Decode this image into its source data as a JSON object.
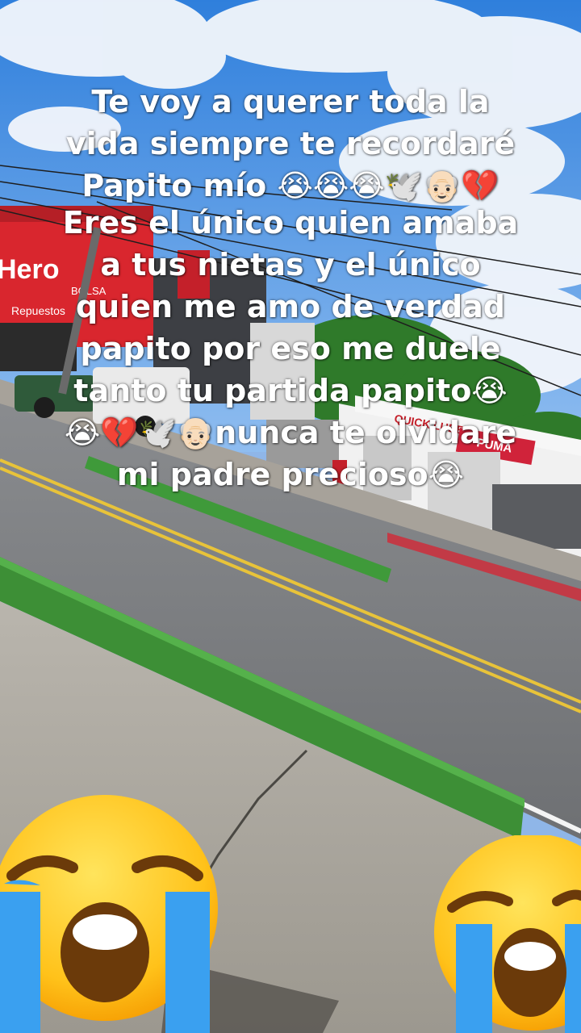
{
  "caption": {
    "line1": "Te voy a querer toda la",
    "line2": "vida siempre te recordaré",
    "line3": "Papito mío 😭😭😭🕊️👴🏻💔",
    "line4": "Eres el único quien amaba",
    "line5": "a tus nietas y el único",
    "line6": "quien me amo de verdad",
    "line7": "papito por eso me duele",
    "line8": "tanto tu partida papito😭",
    "line9": "😭💔🕊️👴🏻nunca te olvidare",
    "line10": "mi padre precioso😭"
  },
  "signs": {
    "hero": "Hero",
    "bolsa": "BOLSA",
    "repuestos": "Repuestos",
    "quick_lube": "QUICK LUBE",
    "puma": "PUMA"
  },
  "colors": {
    "sky": "#3f8fe0",
    "cloud": "#f2f6fb",
    "road": "#7d7f82",
    "median": "#3f9a3a",
    "lane_yellow": "#e8c33a",
    "hero_red": "#d9262e",
    "puma_red": "#d0233a"
  },
  "icons": {
    "left": "loudly-crying-face-icon",
    "right": "loudly-crying-face-icon"
  }
}
